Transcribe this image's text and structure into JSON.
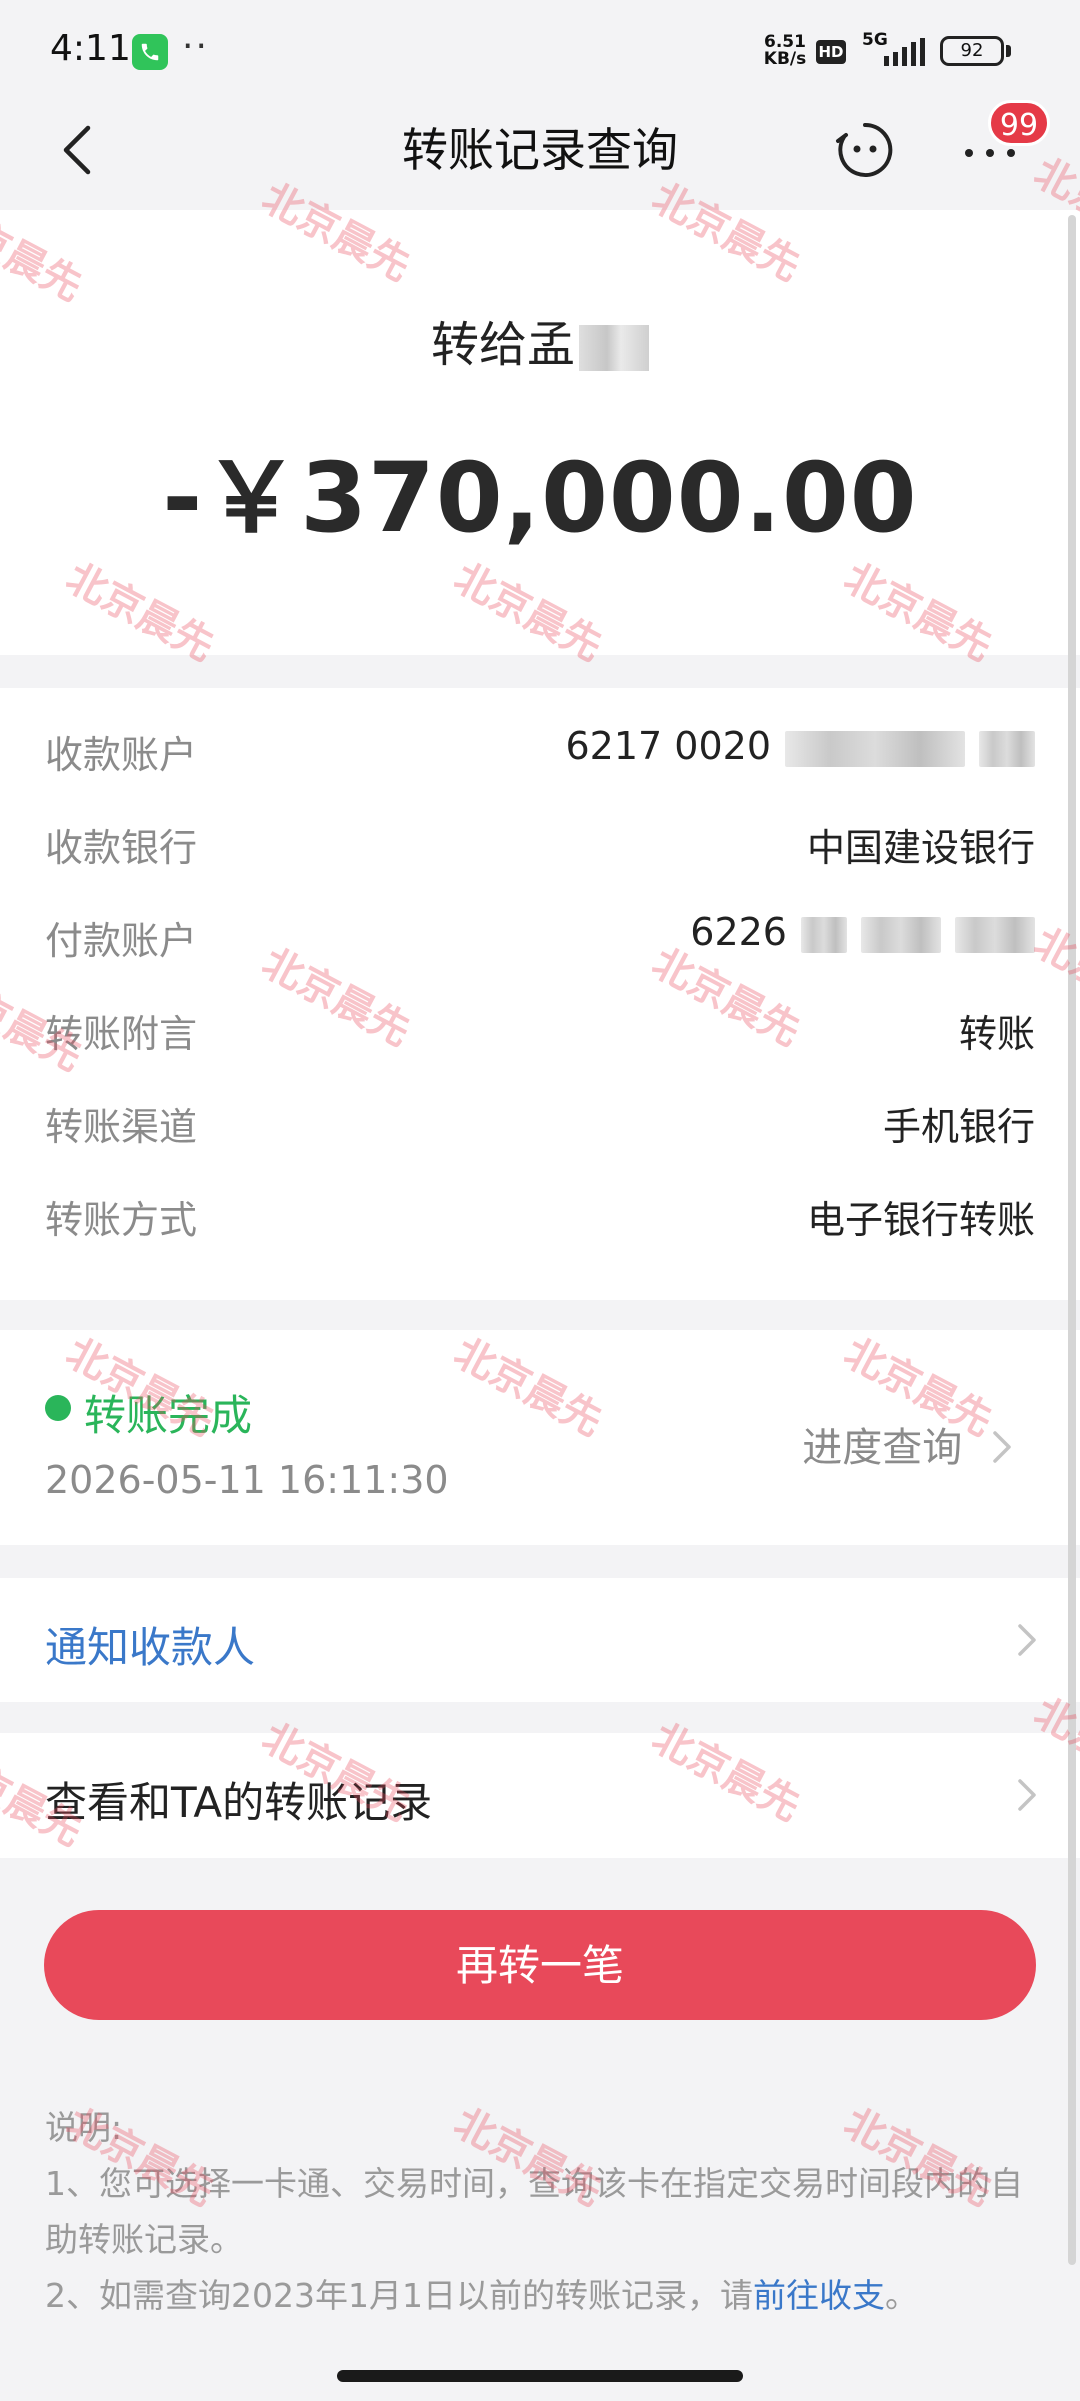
{
  "status_bar": {
    "time": "4:11",
    "dots": "··",
    "net_speed_value": "6.51",
    "net_speed_unit": "KB/s",
    "hd": "HD",
    "network": "5G",
    "battery": "92"
  },
  "header": {
    "title": "转账记录查询",
    "badge_count": "99"
  },
  "summary": {
    "payee_prefix": "转给孟",
    "amount": "-￥370,000.00"
  },
  "details": [
    {
      "label": "收款账户",
      "value": "6217 0020"
    },
    {
      "label": "收款银行",
      "value": "中国建设银行"
    },
    {
      "label": "付款账户",
      "value": "6226"
    },
    {
      "label": "转账附言",
      "value": "转账"
    },
    {
      "label": "转账渠道",
      "value": "手机银行"
    },
    {
      "label": "转账方式",
      "value": "电子银行转账"
    }
  ],
  "status": {
    "text": "转账完成",
    "datetime": "2026-05-11 16:11:30",
    "progress_link": "进度查询"
  },
  "notify_payee": "通知收款人",
  "history_link": "查看和TA的转账记录",
  "primary_button": "再转一笔",
  "notes": {
    "title": "说明:",
    "line1": "1、您可选择一卡通、交易时间，查询该卡在指定交易时间段内的自助转账记录。",
    "line2_prefix": "2、如需查询2023年1月1日以前的转账记录，请",
    "line2_link": "前往收支",
    "line2_suffix": "。"
  },
  "watermark": "北京晨先",
  "colors": {
    "accent_red": "#e8495a",
    "success_green": "#2ab55a",
    "link_blue": "#3a78c9"
  },
  "icons": [
    "phone-call-icon",
    "back-arrow-icon",
    "assistant-face-icon",
    "more-dots-icon",
    "chevron-right-icon"
  ]
}
